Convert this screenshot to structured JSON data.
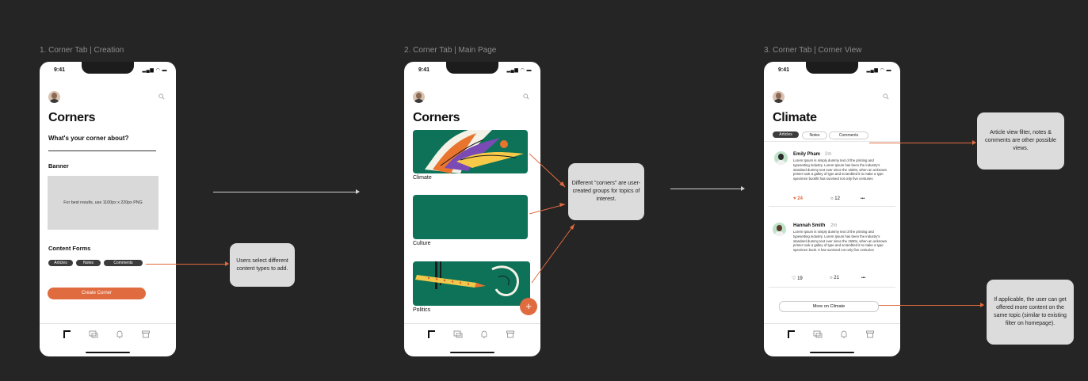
{
  "frames": [
    {
      "label": "1. Corner Tab | Creation"
    },
    {
      "label": "2. Corner Tab | Main Page"
    },
    {
      "label": "3. Corner Tab | Corner View"
    }
  ],
  "status_time": "9:41",
  "creation": {
    "title": "Corners",
    "question": "What's your corner about?",
    "banner_label": "Banner",
    "banner_hint": "For best results, use 1100px x 220px PNG",
    "content_forms_label": "Content Forms",
    "chips": [
      "Articles",
      "Notes",
      "Comments"
    ],
    "create_button": "Create Corner"
  },
  "main": {
    "title": "Corners",
    "cards": [
      "Climate",
      "Culture",
      "Politics"
    ],
    "fab": "+"
  },
  "view": {
    "title": "Climate",
    "tabs": [
      "Articles",
      "Notes",
      "Comments"
    ],
    "posts": [
      {
        "name": "Emily Pham",
        "time": "2m",
        "body": "Lorem Ipsum is simply dummy text of the printing and  typesetting industry. Lorem Ipsum has been the industry's standard dummy text ever since the 1500s, when an unknown printer took a galley of type and scrambled it to make a type specimen bookht has survived not  only five centuries",
        "likes": "24",
        "comments": "12",
        "more": "•••"
      },
      {
        "name": "Hannah Smith",
        "time": "2m",
        "body": "Lorem Ipsum is simply dummy text of the printing and  typesetting industry. Lorem Ipsum has been the industry's standard dummy text ever since the 1500s, when an unknown printer took a galley of type and scrambled it to make a type specimen book. It has survived not  only five centuries",
        "likes": "19",
        "comments": "21",
        "more": "•••"
      }
    ],
    "more_button": "More on Climate"
  },
  "callouts": {
    "content_types": "Users select different content types to add.",
    "corners": "Different \"corners\" are user-created groups for topics of interest.",
    "filters": "Article view filter, notes & comments are other possible views.",
    "more_content": "If applicable, the user can get offered more content on the same topic (similar to existing filter on homepage)."
  },
  "colors": {
    "accent": "#e06b3f",
    "card_green": "#0d7258",
    "canvas": "#252525"
  }
}
